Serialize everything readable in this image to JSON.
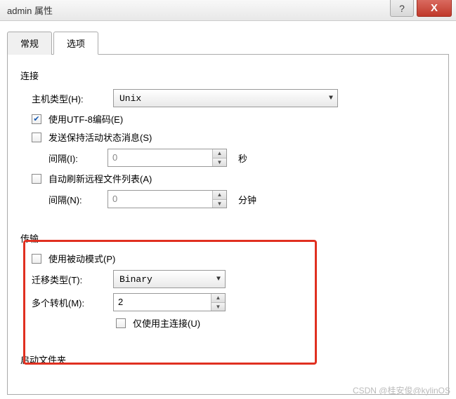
{
  "titlebar": {
    "title": "admin 属性",
    "help": "?",
    "close": "X"
  },
  "tabs": {
    "general": "常规",
    "options": "选项"
  },
  "connection": {
    "title": "连接",
    "host_type_label": "主机类型(H):",
    "host_type_value": "Unix",
    "utf8_label": "使用UTF-8编码(E)",
    "keepalive_label": "发送保持活动状态消息(S)",
    "interval1_label": "间隔(I):",
    "interval1_value": "0",
    "interval1_unit": "秒",
    "autorefresh_label": "自动刷新远程文件列表(A)",
    "interval2_label": "间隔(N):",
    "interval2_value": "0",
    "interval2_unit": "分钟"
  },
  "transfer": {
    "title": "传输",
    "passive_label": "使用被动模式(P)",
    "transfer_type_label": "迁移类型(T):",
    "transfer_type_value": "Binary",
    "multi_label": "多个转机(M):",
    "multi_value": "2",
    "main_conn_label": "仅使用主连接(U)"
  },
  "startup": {
    "title": "启动文件夹"
  },
  "watermark": "CSDN @桂安俊@kylinOS"
}
